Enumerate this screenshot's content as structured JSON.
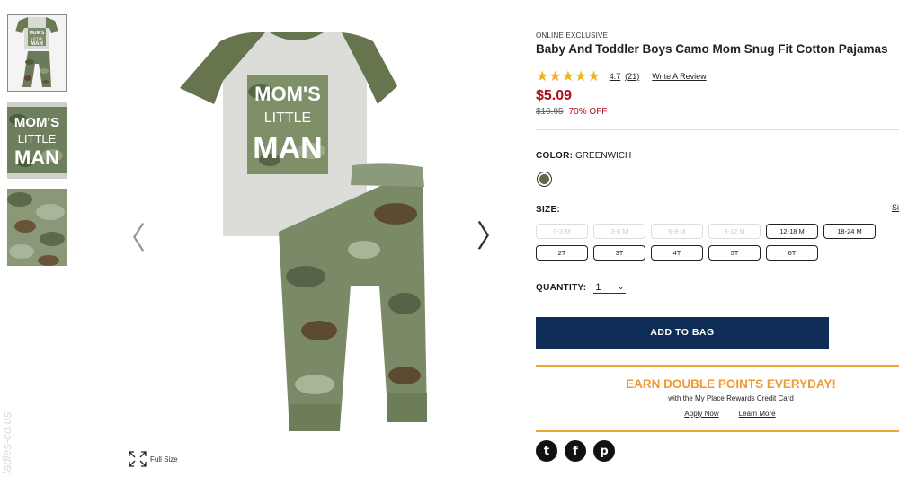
{
  "gallery": {
    "thumbnails": [
      {
        "icon": "pajama-set-thumb",
        "alt": "pajama set"
      },
      {
        "icon": "graphic-closeup-thumb",
        "alt": "graphic close up"
      },
      {
        "icon": "camo-fabric-thumb",
        "alt": "camo fabric"
      }
    ],
    "thumb_graphic_text": [
      "MOM'S",
      "LITTLE",
      "MAN"
    ],
    "main_graphic_text": [
      "MOM'S",
      "LITTLE",
      "MAN"
    ],
    "prev_icon": "chevron-left-icon",
    "next_icon": "chevron-right-icon",
    "full_size_label": "Full Size",
    "watermark": "ladies-co.us"
  },
  "product": {
    "eyebrow": "ONLINE EXCLUSIVE",
    "title": "Baby And Toddler Boys Camo Mom Snug Fit Cotton Pajamas",
    "rating": {
      "stars": "★★★★★",
      "value": "4.7",
      "count": "(21)",
      "write_review": "Write A Review"
    },
    "price": "$5.09",
    "original_price": "$16.95",
    "discount": "70% OFF"
  },
  "color": {
    "label": "COLOR:",
    "value": "GREENWICH",
    "swatch_color": "#5a6b4a"
  },
  "size": {
    "label": "SIZE:",
    "guide": "Si",
    "options": [
      {
        "label": "0-3 M",
        "available": false
      },
      {
        "label": "3-6 M",
        "available": false
      },
      {
        "label": "6-9 M",
        "available": false
      },
      {
        "label": "9-12 M",
        "available": false
      },
      {
        "label": "12-18 M",
        "available": true
      },
      {
        "label": "18-24 M",
        "available": true
      },
      {
        "label": "2T",
        "available": true
      },
      {
        "label": "3T",
        "available": true
      },
      {
        "label": "4T",
        "available": true
      },
      {
        "label": "5T",
        "available": true
      },
      {
        "label": "6T",
        "available": true
      }
    ]
  },
  "quantity": {
    "label": "QUANTITY:",
    "value": "1",
    "icon": "chevron-down-icon"
  },
  "add_to_bag": "ADD TO BAG",
  "promo": {
    "title": "EARN DOUBLE POINTS EVERYDAY!",
    "subtitle": "with the My Place Rewards Credit Card",
    "apply": "Apply Now",
    "learn": "Learn More"
  },
  "social": [
    {
      "name": "twitter-icon",
      "glyph": "t"
    },
    {
      "name": "facebook-icon",
      "glyph": "f"
    },
    {
      "name": "pinterest-icon",
      "glyph": "p"
    }
  ],
  "colors": {
    "price_red": "#b0101e",
    "button_navy": "#0d2d57",
    "promo_orange": "#ef9a33",
    "star_gold": "#f2b21e"
  }
}
